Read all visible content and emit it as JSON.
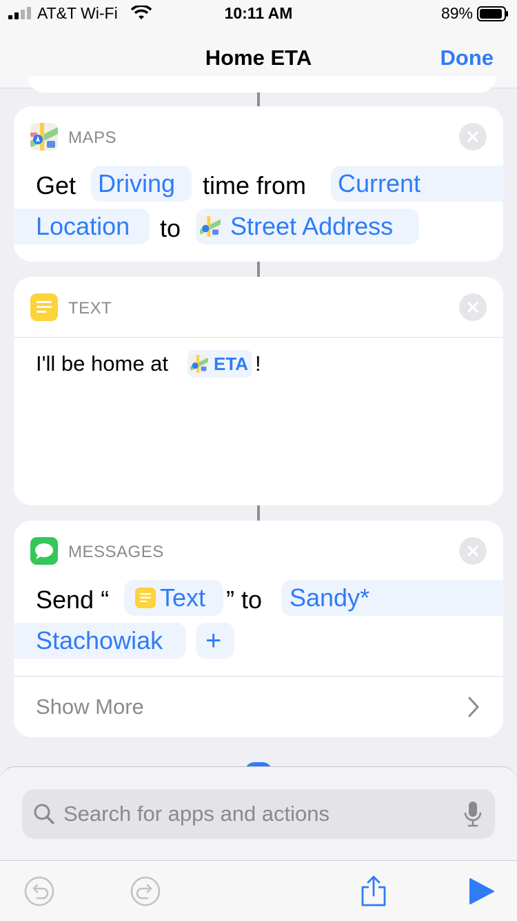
{
  "status_bar": {
    "carrier": "AT&T Wi-Fi",
    "time": "10:11 AM",
    "battery": "89%"
  },
  "nav": {
    "title": "Home ETA",
    "done_label": "Done"
  },
  "maps_action": {
    "app_name": "MAPS",
    "line1": {
      "get": "Get",
      "mode": "Driving",
      "time_from": "time from",
      "origin_part1": "Current"
    },
    "line2": {
      "origin_part2": "Location",
      "to": "to",
      "destination": "Street Address"
    }
  },
  "text_action": {
    "app_name": "TEXT",
    "body_prefix": "I'll be home at",
    "variable": "ETA",
    "body_suffix": "!"
  },
  "messages_action": {
    "app_name": "MESSAGES",
    "line1": {
      "send": "Send “",
      "variable": "Text",
      "close_quote_to": "” to",
      "recipient_part1": "Sandy*"
    },
    "line2": {
      "recipient_part2": "Stachowiak",
      "add": "+"
    },
    "show_more": "Show More"
  },
  "search": {
    "placeholder": "Search for apps and actions"
  },
  "colors": {
    "accent": "#2f7cf6",
    "token_bg": "#eef4fe",
    "background": "#efeff4",
    "text_icon": "#fdd33c",
    "messages_icon": "#34c759"
  },
  "icons": {
    "maps": "maps-icon",
    "text": "text-note-icon",
    "messages": "speech-bubble-icon",
    "close": "close-icon",
    "chevron": "chevron-right-icon",
    "search": "search-icon",
    "mic": "microphone-icon",
    "undo": "undo-icon",
    "redo": "redo-icon",
    "share": "share-icon",
    "play": "play-icon"
  }
}
